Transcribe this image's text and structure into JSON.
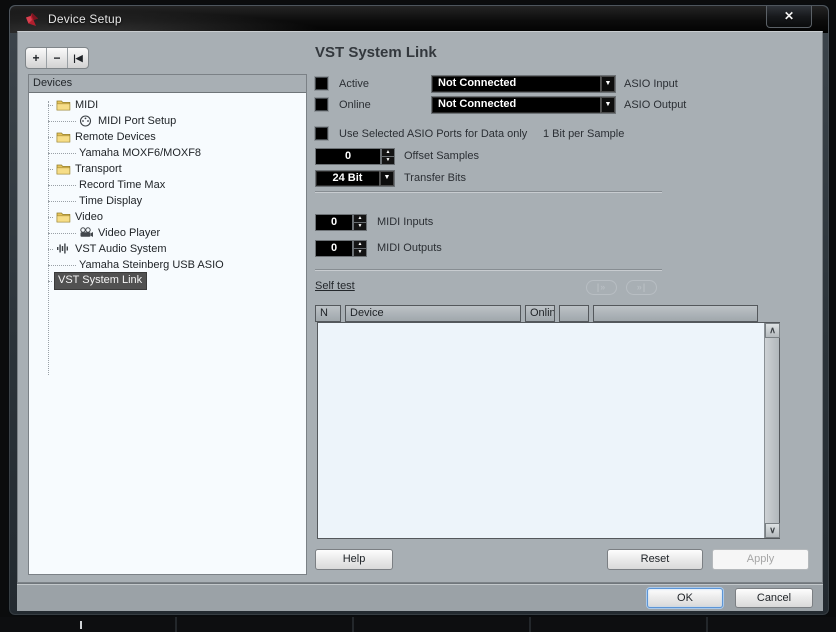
{
  "window": {
    "title": "Device Setup"
  },
  "icons": {
    "close": "✕",
    "add": "+",
    "remove": "−",
    "reset_devices": "|◀",
    "dropdown_arrow": "▼",
    "spin_up": "▲",
    "spin_down": "▼",
    "scroll_up": "∧",
    "scroll_down": "∨",
    "play_from_start": "|»",
    "play_to_end": "»|"
  },
  "devices_panel": {
    "header": "Devices",
    "items": [
      {
        "label": "MIDI",
        "icon": "folder",
        "level": 1,
        "selected": false
      },
      {
        "label": "MIDI Port Setup",
        "icon": "midi-port",
        "level": 2,
        "selected": false
      },
      {
        "label": "Remote Devices",
        "icon": "folder",
        "level": 1,
        "selected": false
      },
      {
        "label": "Yamaha MOXF6/MOXF8",
        "icon": "none",
        "level": 2,
        "selected": false
      },
      {
        "label": "Transport",
        "icon": "folder",
        "level": 1,
        "selected": false
      },
      {
        "label": "Record Time Max",
        "icon": "none",
        "level": 2,
        "selected": false
      },
      {
        "label": "Time Display",
        "icon": "none",
        "level": 2,
        "selected": false
      },
      {
        "label": "Video",
        "icon": "folder",
        "level": 1,
        "selected": false
      },
      {
        "label": "Video Player",
        "icon": "camera",
        "level": 2,
        "selected": false
      },
      {
        "label": "VST Audio System",
        "icon": "waveform",
        "level": 1,
        "selected": false
      },
      {
        "label": "Yamaha Steinberg USB ASIO",
        "icon": "none",
        "level": 2,
        "selected": false
      },
      {
        "label": "VST System Link",
        "icon": "none",
        "level": 0,
        "selected": true
      }
    ]
  },
  "main": {
    "title": "VST System Link",
    "active_row": {
      "checkbox_label": "Active",
      "dropdown_value": "Not Connected",
      "side_label": "ASIO Input"
    },
    "online_row": {
      "checkbox_label": "Online",
      "dropdown_value": "Not Connected",
      "side_label": "ASIO Output"
    },
    "data_only_row": {
      "checkbox_label": "Use Selected ASIO Ports for Data only",
      "note": "1 Bit per Sample"
    },
    "offset_samples": {
      "value": "0",
      "label": "Offset Samples"
    },
    "transfer_bits": {
      "value": "24 Bit",
      "label": "Transfer Bits"
    },
    "midi_inputs": {
      "value": "0",
      "label": "MIDI Inputs"
    },
    "midi_outputs": {
      "value": "0",
      "label": "MIDI Outputs"
    },
    "self_test_label": "Self test",
    "table": {
      "columns": [
        "N",
        "Device",
        "Onlin",
        "",
        ""
      ],
      "rows": []
    },
    "help_button": "Help",
    "reset_button": "Reset",
    "apply_button": "Apply"
  },
  "footer": {
    "ok_button": "OK",
    "cancel_button": "Cancel"
  }
}
